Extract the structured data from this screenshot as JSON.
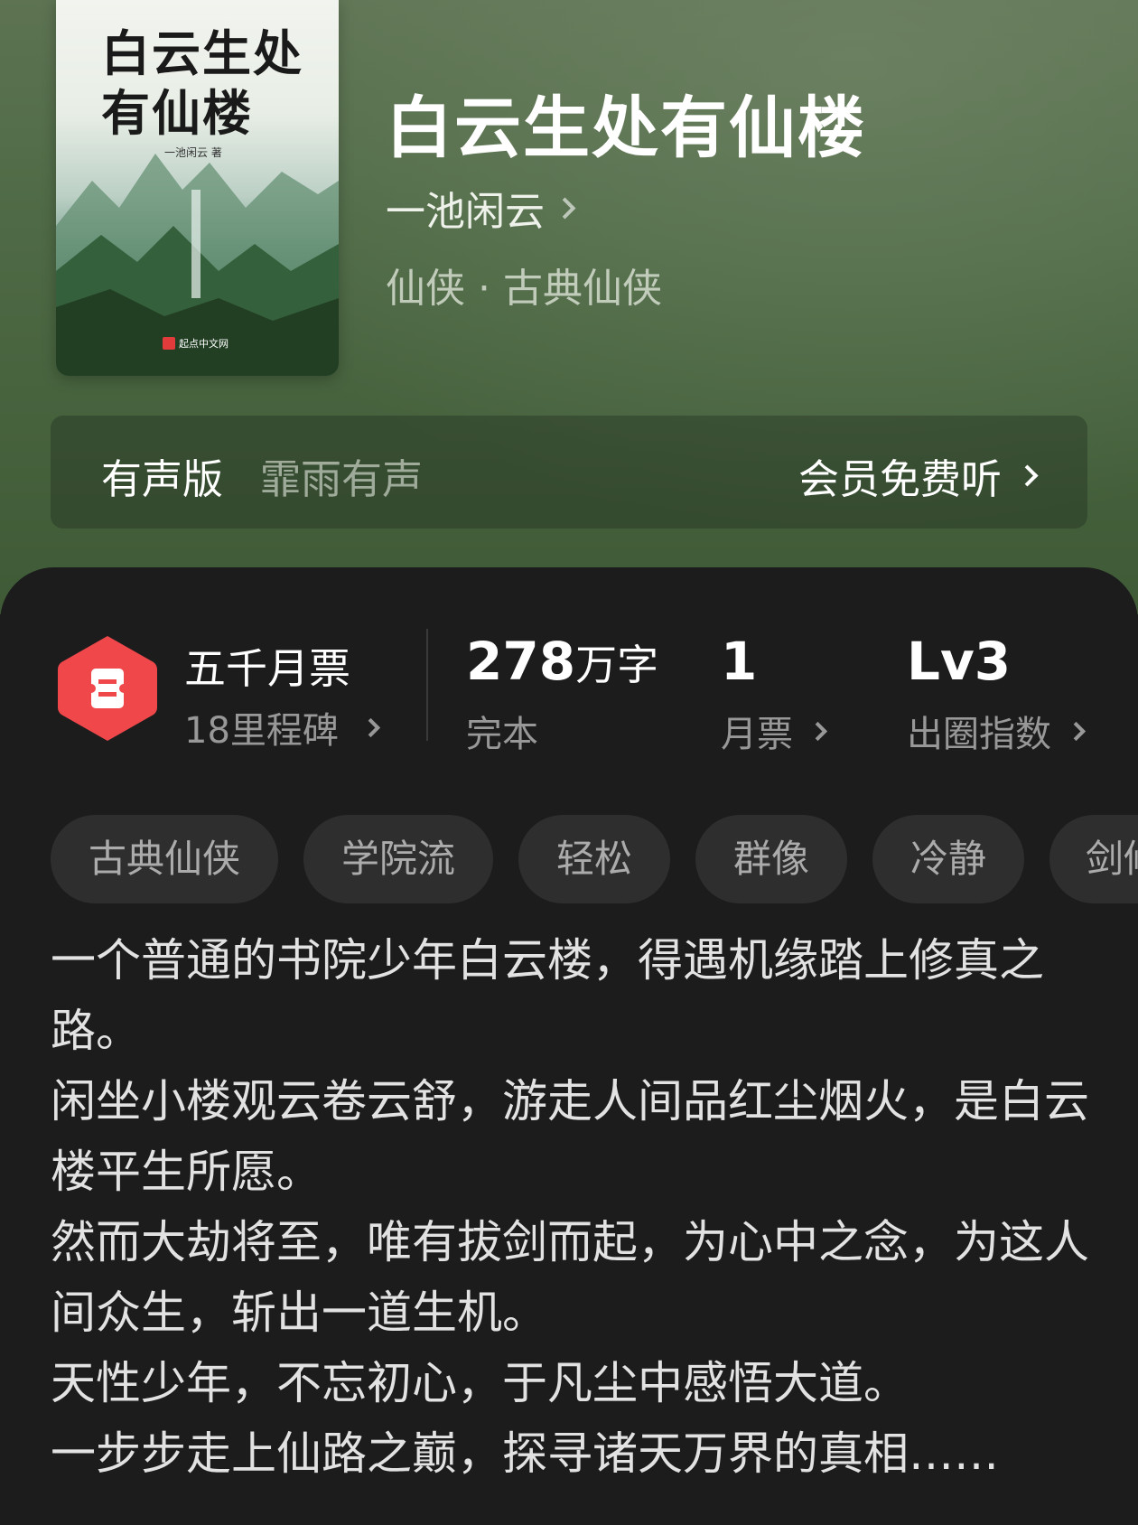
{
  "cover": {
    "title_art": "白云生处有仙楼",
    "author_art": "一池闲云 著",
    "publisher_art": "起点中文网"
  },
  "book": {
    "title": "白云生处有仙楼",
    "author": "一池闲云",
    "genre": "仙侠 · 古典仙侠"
  },
  "audio": {
    "label": "有声版",
    "narrator": "霏雨有声",
    "action": "会员免费听"
  },
  "stats": {
    "badge_name": "五千月票",
    "badge_sub": "18里程碑",
    "words_value": "278",
    "words_unit": "万字",
    "words_label": "完本",
    "monthly_value": "1",
    "monthly_label": "月票",
    "level_value": "Lv3",
    "level_label": "出圈指数"
  },
  "tags": [
    "古典仙侠",
    "学院流",
    "轻松",
    "群像",
    "冷静",
    "剑修"
  ],
  "description": [
    "一个普通的书院少年白云楼，得遇机缘踏上修真之路。",
    "闲坐小楼观云卷云舒，游走人间品红尘烟火，是白云楼平生所愿。",
    "然而大劫将至，唯有拔剑而起，为心中之念，为这人间众生，斩出一道生机。",
    "天性少年，不忘初心，于凡尘中感悟大道。",
    "一步步走上仙路之巅，探寻诸天万界的真相……"
  ],
  "colors": {
    "hero_green": "#4f6a46",
    "panel_bg": "#1c1c1c",
    "badge_red": "#f0474b",
    "tag_bg": "#2e2e2e"
  }
}
